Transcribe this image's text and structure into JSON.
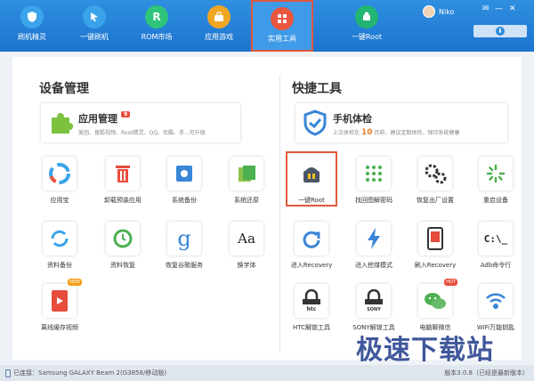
{
  "tabs": [
    {
      "label": "刷机精灵",
      "icon": "shield-icon",
      "color": "#3aa3ea"
    },
    {
      "label": "一键刷机",
      "icon": "cursor-icon",
      "color": "#3aa3ea"
    },
    {
      "label": "ROM市场",
      "icon": "rom-icon",
      "color": "#2ec47a"
    },
    {
      "label": "应用游戏",
      "icon": "app-icon",
      "color": "#f0a623"
    },
    {
      "label": "实用工具",
      "icon": "tools-icon",
      "color": "#e9553f"
    },
    {
      "label": "一键Root",
      "icon": "root-icon",
      "color": "#22b573"
    }
  ],
  "user": {
    "name": "Niko"
  },
  "left": {
    "title": "设备管理",
    "card": {
      "title": "应用管理",
      "badge": "9",
      "sub": "美团、搜狐视频、Root精灵、QQ、优酷、手...可升级"
    },
    "tools": [
      {
        "label": "应用宝",
        "icon": "app-store-icon"
      },
      {
        "label": "卸载预装应用",
        "icon": "trash-icon"
      },
      {
        "label": "系统备份",
        "icon": "system-backup-icon"
      },
      {
        "label": "系统还原",
        "icon": "system-restore-icon"
      },
      {
        "label": "资料备份",
        "icon": "data-backup-icon"
      },
      {
        "label": "资料恢复",
        "icon": "data-restore-icon"
      },
      {
        "label": "恢复谷歌服务",
        "icon": "google-icon"
      },
      {
        "label": "换字体",
        "icon": "font-icon"
      },
      {
        "label": "离线缓存视频",
        "icon": "video-cache-icon",
        "corner": "NEW"
      }
    ]
  },
  "right": {
    "title": "快捷工具",
    "card": {
      "title": "手机体检",
      "sub_a": "上次体检在",
      "days": "10",
      "sub_b": "月前，建议定期体检，保持系统健康"
    },
    "tools": [
      {
        "label": "一键Root",
        "icon": "android-root-icon"
      },
      {
        "label": "找回图解密码",
        "icon": "pattern-lock-icon"
      },
      {
        "label": "恢复出厂设置",
        "icon": "factory-reset-icon"
      },
      {
        "label": "重启设备",
        "icon": "reboot-icon"
      },
      {
        "label": "进入Recovery",
        "icon": "recovery-icon"
      },
      {
        "label": "进入挖煤模式",
        "icon": "flash-mode-icon"
      },
      {
        "label": "刷入Recovery",
        "icon": "flash-recovery-icon"
      },
      {
        "label": "Adb命令行",
        "icon": "adb-terminal-icon"
      },
      {
        "label": "HTC解锁工具",
        "icon": "htc-lock-icon"
      },
      {
        "label": "SONY解锁工具",
        "icon": "sony-lock-icon"
      },
      {
        "label": "电脑聊微信",
        "icon": "wechat-icon",
        "corner": "HOT"
      },
      {
        "label": "WiFi万能钥匙",
        "icon": "wifi-key-icon"
      }
    ]
  },
  "status": {
    "connected": "已连接：Samsung GALAXY Beam 2(G3858/移动版)",
    "version": "版本3.0.8（已经是最新版本）"
  },
  "watermark": "极速下载站"
}
